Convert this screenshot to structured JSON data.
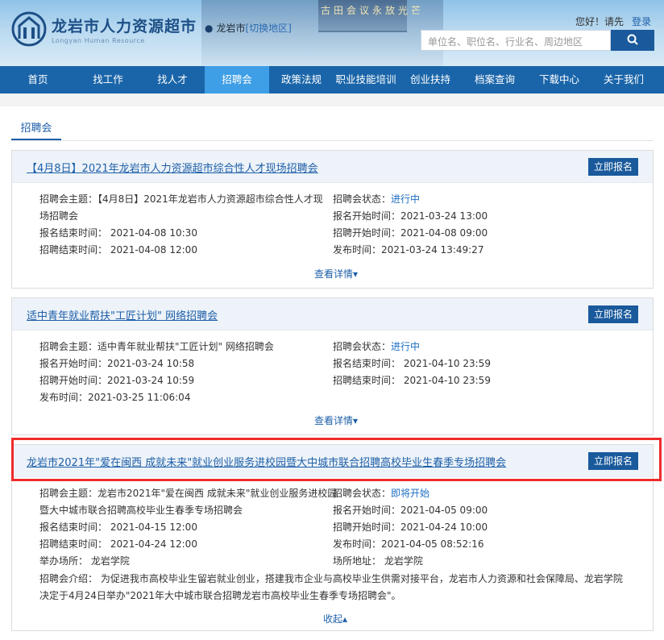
{
  "header": {
    "site_title": "龙岩市人力资源超市",
    "site_subtitle": "Longyan Human Resource",
    "banner_text": "古田会议永放光芒",
    "location": "龙岩市",
    "switch_region": "[切换地区]",
    "greeting": "您好！请先",
    "login": "登录",
    "search_placeholder": "单位名、职位名、行业名、周边地区",
    "search_icon": "search-icon"
  },
  "nav": [
    "首页",
    "找工作",
    "找人才",
    "招聘会",
    "政策法规",
    "职业技能培训",
    "创业扶持",
    "档案查询",
    "下载中心",
    "关于我们"
  ],
  "section_tab": "招聘会",
  "apply_label": "立即报名",
  "cards": [
    {
      "title": "【4月8日】2021年龙岩市人力资源超市综合性人才现场招聘会",
      "theme_a": "招聘会主题：【4月8日】2021年龙岩市人力资源超市综合性人才现",
      "theme_b": "场招聘会",
      "status_label": "招聘会状态：",
      "status": "进行中",
      "reg_start": "报名开始时间：2021-03-24 13:00",
      "reg_end": "报名结束时间：  2021-04-08 10:30",
      "fair_start": "招聘开始时间：2021-04-08 09:00",
      "fair_end": "招聘结束时间：  2021-04-08 12:00",
      "publish": "发布时间：2021-03-24 13:49:27",
      "toggle": "查看详情"
    },
    {
      "title": "适中青年就业帮扶\"工匠计划\" 网络招聘会",
      "theme": "招聘会主题：适中青年就业帮扶\"工匠计划\" 网络招聘会",
      "status_label": "招聘会状态：",
      "status": "进行中",
      "reg_start": "报名开始时间：2021-03-24 10:58",
      "reg_end": "报名结束时间：  2021-04-10 23:59",
      "fair_start": "招聘开始时间：2021-03-24 10:59",
      "fair_end": "招聘结束时间：  2021-04-10 23:59",
      "publish": "发布时间：2021-03-25 11:06:04",
      "toggle": "查看详情"
    },
    {
      "title": "龙岩市2021年\"爱在闽西 成就未来\"就业创业服务进校园暨大中城市联合招聘高校毕业生春季专场招聘会",
      "theme_a": "招聘会主题：龙岩市2021年\"爱在闽西 成就未来\"就业创业服务进校园",
      "theme_b": "暨大中城市联合招聘高校毕业生春季专场招聘会",
      "status_label": "招聘会状态：",
      "status": "即将开始",
      "reg_start": "报名开始时间：2021-04-05 09:00",
      "reg_end": "报名结束时间：  2021-04-15 12:00",
      "fair_start": "招聘开始时间：2021-04-24 10:00",
      "fair_end": "招聘结束时间：  2021-04-24 12:00",
      "publish": "发布时间：2021-04-05 08:52:16",
      "organizer": "举办场所：  龙岩学院",
      "venue": "场所地址：  龙岩学院",
      "intro_a": "招聘会介绍：  为促进我市高校毕业生留岩就业创业，搭建我市企业与高校毕业生供需对接平台，龙岩市人力资源和社会保障局、龙岩学院",
      "intro_b": "决定于4月24日举办\"2021年大中城市联合招聘龙岩市高校毕业生春季专场招聘会\"。",
      "toggle": "收起"
    }
  ]
}
